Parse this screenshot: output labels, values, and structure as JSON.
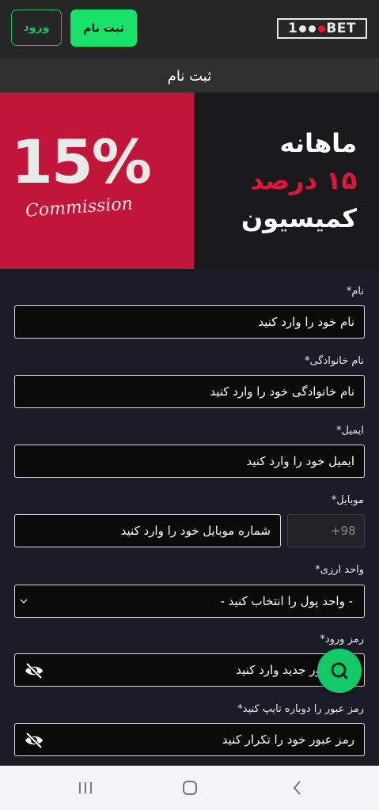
{
  "header": {
    "login_label": "ورود",
    "register_label": "ثبت نام",
    "logo_text_pre": "1",
    "logo_text_post": "BET"
  },
  "page_title": "ثبت نام",
  "banner": {
    "percent": "15%",
    "commission": "Commission",
    "line1": "ماهانه",
    "line2": "۱۵ درصد",
    "line3": "کمیسیون"
  },
  "form": {
    "first_name": {
      "label": "نام*",
      "placeholder": "نام خود را وارد کنید"
    },
    "last_name": {
      "label": "نام خانوادگی*",
      "placeholder": "نام خانوادگی خود را وارد کنید"
    },
    "email": {
      "label": "ایمیل*",
      "placeholder": "ایمیل خود را وارد کنید"
    },
    "mobile": {
      "label": "موبایل*",
      "code": "+98",
      "placeholder": "شماره موبایل خود را وارد کنید"
    },
    "currency": {
      "label": "واحد ارزی*",
      "selected": "- واحد پول را انتخاب کنید -"
    },
    "password": {
      "label": "رمز ورود*",
      "placeholder": "رمز عبور جدید وارد کنید"
    },
    "password_repeat": {
      "label": "رمز عبور را دوباره تایپ کنید*",
      "placeholder": "رمز عبور خود را تکرار کنید"
    }
  },
  "colors": {
    "accent": "#19e26b",
    "banner_red": "#c2153a",
    "background": "#1c1c28"
  }
}
